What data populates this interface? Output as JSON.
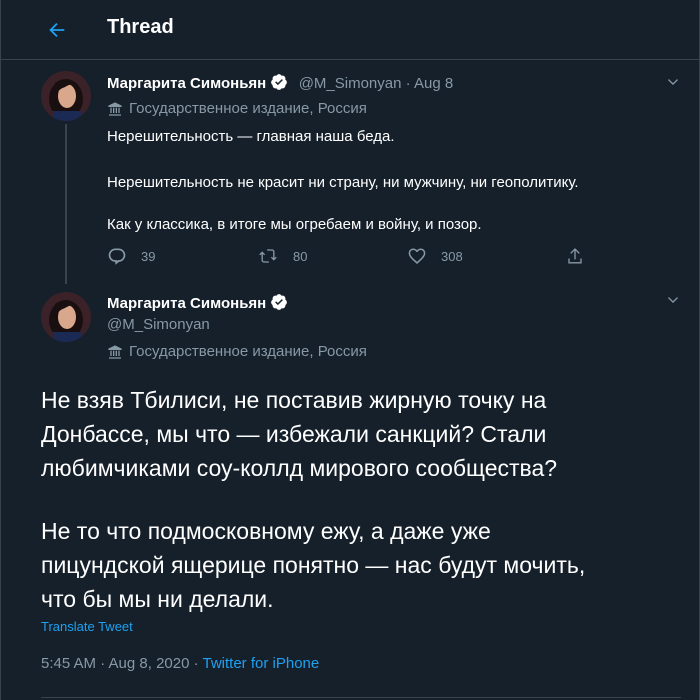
{
  "header": {
    "title": "Thread"
  },
  "tweet1": {
    "display_name": "Маргарита Симоньян",
    "handle": "@M_Simonyan",
    "separator": " · ",
    "date": "Aug 8",
    "label": "Государственное издание, Россия",
    "lines": [
      "Нерешительность — главная наша беда.",
      "Нерешительность не красит ни страну, ни мужчину, ни геополитику.",
      "Как у классика, в итоге мы огребаем и войну, и позор."
    ],
    "replies": "39",
    "retweets": "80",
    "likes": "308"
  },
  "tweet2": {
    "display_name": "Маргарита Симоньян",
    "handle": "@M_Simonyan",
    "label": "Государственное издание, Россия",
    "paragraph1": [
      "Не взяв Тбилиси, не поставив жирную точку на",
      "Донбассе, мы что — избежали санкций? Стали",
      "любимчиками соу-коллд мирового сообщества?"
    ],
    "paragraph2": [
      "Не то что подмосковному ежу, а даже уже",
      "пицундской ящерице понятно — нас будут мочить,",
      "что бы мы ни делали."
    ],
    "translate": "Translate Tweet",
    "time": "5:45 AM · Aug 8, 2020 · ",
    "source": "Twitter for iPhone"
  },
  "colors": {
    "background": "#15202b",
    "accent": "#1da1f2",
    "secondary_text": "#8899a6",
    "divider": "#38444d"
  },
  "icons": {
    "back": "arrow-left-icon",
    "verified": "verified-badge-icon",
    "label": "state-media-icon",
    "reply": "reply-icon",
    "retweet": "retweet-icon",
    "like": "heart-icon",
    "share": "share-icon",
    "more": "chevron-down-icon"
  }
}
